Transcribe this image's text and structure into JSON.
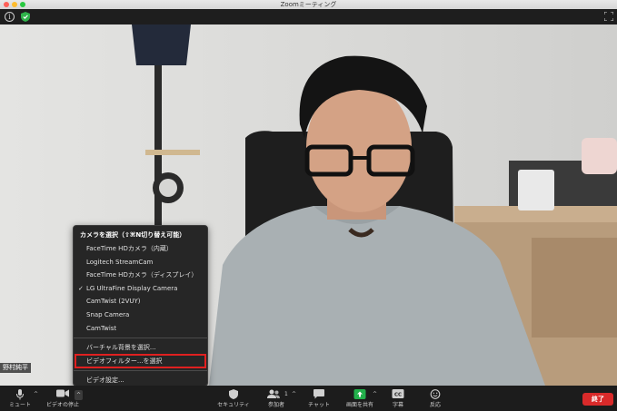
{
  "window": {
    "title": "Zoomミーティング"
  },
  "participant": {
    "name": "野村純平"
  },
  "camera_menu": {
    "header": "カメラを選択（⇧⌘N切り替え可能）",
    "cameras": [
      {
        "label": "FaceTime HDカメラ（内蔵）",
        "checked": false
      },
      {
        "label": "Logitech StreamCam",
        "checked": false
      },
      {
        "label": "FaceTime HDカメラ（ディスプレイ）",
        "checked": false
      },
      {
        "label": "LG UltraFine Display Camera",
        "checked": true
      },
      {
        "label": "CamTwist (2VUY)",
        "checked": false
      },
      {
        "label": "Snap Camera",
        "checked": false
      },
      {
        "label": "CamTwist",
        "checked": false
      }
    ],
    "check_mark": "✓",
    "virtual_background": "バーチャル背景を選択...",
    "video_filter": "ビデオフィルター...を選択",
    "video_settings": "ビデオ設定..."
  },
  "toolbar": {
    "mute": "ミュート",
    "stop_video": "ビデオの停止",
    "security": "セキュリティ",
    "participants": "参加者",
    "participants_count": "1",
    "chat": "チャット",
    "share_screen": "画面を共有",
    "captions": "字幕",
    "captions_icon_text": "CC",
    "reactions": "反応",
    "end": "終了",
    "share_color": "#22b04b",
    "end_color": "#d92a2a"
  }
}
